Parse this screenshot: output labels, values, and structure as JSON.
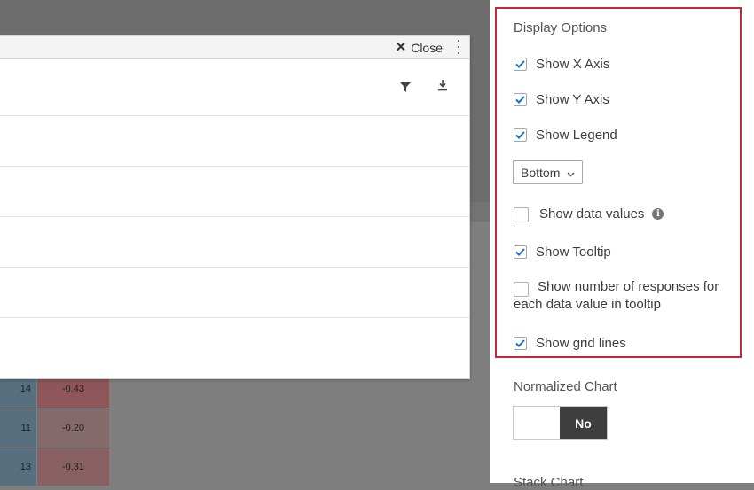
{
  "heatmap": {
    "rows": [
      {
        "left": "14",
        "right": "-0.43",
        "right_color": "#8e5659"
      },
      {
        "left": "11",
        "right": "-0.20",
        "right_color": "#846a6b"
      },
      {
        "left": "13",
        "right": "-0.31",
        "right_color": "#896062"
      }
    ]
  },
  "modal": {
    "close_label": "Close",
    "close_icon": "close-icon",
    "menu_icon": "kebab-menu-icon",
    "filter_icon": "filter-icon",
    "download_icon": "download-icon"
  },
  "display_options": {
    "title": "Display Options",
    "show_x_axis": {
      "label": "Show X Axis",
      "checked": true
    },
    "show_y_axis": {
      "label": "Show Y Axis",
      "checked": true
    },
    "show_legend": {
      "label": "Show Legend",
      "checked": true
    },
    "legend_position": {
      "value": "Bottom",
      "options": [
        "Bottom"
      ]
    },
    "show_data_values": {
      "label": "Show data values",
      "checked": false,
      "info_icon": "info-icon"
    },
    "show_tooltip": {
      "label": "Show Tooltip",
      "checked": true
    },
    "show_responses": {
      "label_line1": "Show number of responses for",
      "label_line2": "each data value in tooltip",
      "checked": false
    },
    "show_grid_lines": {
      "label": "Show grid lines",
      "checked": true
    }
  },
  "normalized_chart": {
    "title": "Normalized Chart",
    "toggle_value": "No"
  },
  "stack_chart": {
    "title": "Stack Chart"
  },
  "colors": {
    "highlight_border": "#c42a36",
    "checkmark": "#1f6fbf",
    "toggle_on": "#3e3e3e"
  }
}
